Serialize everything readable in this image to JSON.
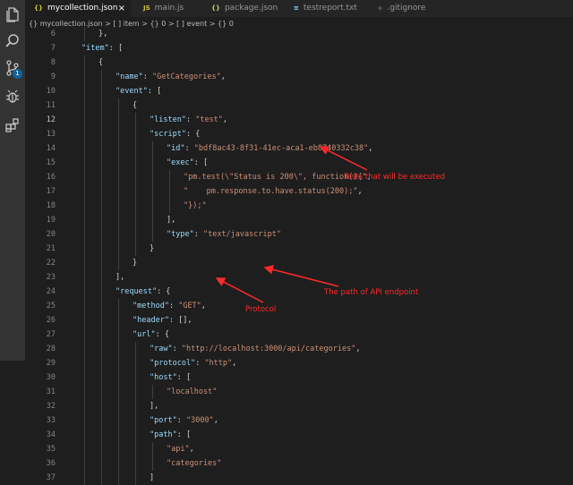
{
  "tabs": [
    {
      "icon": "{}",
      "label": "mycollection.json",
      "active": true,
      "close": "×"
    },
    {
      "icon": "JS",
      "label": "main.js"
    },
    {
      "icon": "{}",
      "label": "package.json"
    },
    {
      "icon": "≡",
      "label": "testreport.txt"
    },
    {
      "icon": "◆",
      "label": ".gitignore"
    }
  ],
  "breadcrumb": "{} mycollection.json > [ ] item > {} 0 > [ ] event > {} 0",
  "source_control_badge": "1",
  "annotations": {
    "tests": "Tests that will be executed",
    "path": "The path of API endpoint",
    "protocol": "Protocol"
  },
  "colors": {
    "annotation": "#ff2a2a",
    "key": "#9cdcfe",
    "string": "#ce9178"
  },
  "activity_icons": [
    "files-icon",
    "search-icon",
    "source-control-icon",
    "debug-icon",
    "extensions-icon"
  ],
  "lines": [
    {
      "n": "6",
      "indent": 2,
      "parts": [
        [
          "p",
          "},"
        ]
      ]
    },
    {
      "n": "7",
      "indent": 1,
      "parts": [
        [
          "k",
          "\"item\""
        ],
        [
          "p",
          ": ["
        ]
      ]
    },
    {
      "n": "8",
      "indent": 2,
      "parts": [
        [
          "p",
          "{"
        ]
      ]
    },
    {
      "n": "9",
      "indent": 3,
      "parts": [
        [
          "k",
          "\"name\""
        ],
        [
          "p",
          ": "
        ],
        [
          "s",
          "\"GetCategories\""
        ],
        [
          "p",
          ","
        ]
      ]
    },
    {
      "n": "10",
      "indent": 3,
      "parts": [
        [
          "k",
          "\"event\""
        ],
        [
          "p",
          ": ["
        ]
      ]
    },
    {
      "n": "11",
      "indent": 4,
      "parts": [
        [
          "p",
          "{"
        ]
      ]
    },
    {
      "n": "12",
      "indent": 5,
      "parts": [
        [
          "k",
          "\"listen\""
        ],
        [
          "p",
          ": "
        ],
        [
          "s",
          "\"test\""
        ],
        [
          "p",
          ","
        ]
      ]
    },
    {
      "n": "13",
      "indent": 5,
      "parts": [
        [
          "k",
          "\"script\""
        ],
        [
          "p",
          ": {"
        ]
      ]
    },
    {
      "n": "14",
      "indent": 6,
      "parts": [
        [
          "k",
          "\"id\""
        ],
        [
          "p",
          ": "
        ],
        [
          "s",
          "\"bdf8ac43-8f31-41ec-aca1-eb8740332c38\""
        ],
        [
          "p",
          ","
        ]
      ]
    },
    {
      "n": "15",
      "indent": 6,
      "parts": [
        [
          "k",
          "\"exec\""
        ],
        [
          "p",
          ": ["
        ]
      ]
    },
    {
      "n": "16",
      "indent": 7,
      "parts": [
        [
          "s",
          "\"pm.test(\\\"Status is 200\\\", function(){\""
        ],
        [
          "p",
          ","
        ]
      ]
    },
    {
      "n": "17",
      "indent": 7,
      "parts": [
        [
          "s",
          "\"    pm.response.to.have.status(200);\""
        ],
        [
          "p",
          ","
        ]
      ]
    },
    {
      "n": "18",
      "indent": 7,
      "parts": [
        [
          "s",
          "\"});\""
        ]
      ]
    },
    {
      "n": "19",
      "indent": 6,
      "parts": [
        [
          "p",
          "],"
        ]
      ]
    },
    {
      "n": "20",
      "indent": 6,
      "parts": [
        [
          "k",
          "\"type\""
        ],
        [
          "p",
          ": "
        ],
        [
          "s",
          "\"text/javascript\""
        ]
      ]
    },
    {
      "n": "21",
      "indent": 5,
      "parts": [
        [
          "p",
          "}"
        ]
      ]
    },
    {
      "n": "22",
      "indent": 4,
      "parts": [
        [
          "p",
          "}"
        ]
      ]
    },
    {
      "n": "23",
      "indent": 3,
      "parts": [
        [
          "p",
          "],"
        ]
      ]
    },
    {
      "n": "24",
      "indent": 3,
      "parts": [
        [
          "k",
          "\"request\""
        ],
        [
          "p",
          ": {"
        ]
      ]
    },
    {
      "n": "25",
      "indent": 4,
      "parts": [
        [
          "k",
          "\"method\""
        ],
        [
          "p",
          ": "
        ],
        [
          "s",
          "\"GET\""
        ],
        [
          "p",
          ","
        ]
      ]
    },
    {
      "n": "26",
      "indent": 4,
      "parts": [
        [
          "k",
          "\"header\""
        ],
        [
          "p",
          ": [],"
        ]
      ]
    },
    {
      "n": "27",
      "indent": 4,
      "parts": [
        [
          "k",
          "\"url\""
        ],
        [
          "p",
          ": {"
        ]
      ]
    },
    {
      "n": "28",
      "indent": 5,
      "parts": [
        [
          "k",
          "\"raw\""
        ],
        [
          "p",
          ": "
        ],
        [
          "s",
          "\"http://localhost:3000/api/categories\""
        ],
        [
          "p",
          ","
        ]
      ]
    },
    {
      "n": "29",
      "indent": 5,
      "parts": [
        [
          "k",
          "\"protocol\""
        ],
        [
          "p",
          ": "
        ],
        [
          "s",
          "\"http\""
        ],
        [
          "p",
          ","
        ]
      ]
    },
    {
      "n": "30",
      "indent": 5,
      "parts": [
        [
          "k",
          "\"host\""
        ],
        [
          "p",
          ": ["
        ]
      ]
    },
    {
      "n": "31",
      "indent": 6,
      "parts": [
        [
          "s",
          "\"localhost\""
        ]
      ]
    },
    {
      "n": "32",
      "indent": 5,
      "parts": [
        [
          "p",
          "],"
        ]
      ]
    },
    {
      "n": "33",
      "indent": 5,
      "parts": [
        [
          "k",
          "\"port\""
        ],
        [
          "p",
          ": "
        ],
        [
          "s",
          "\"3000\""
        ],
        [
          "p",
          ","
        ]
      ]
    },
    {
      "n": "34",
      "indent": 5,
      "parts": [
        [
          "k",
          "\"path\""
        ],
        [
          "p",
          ": ["
        ]
      ]
    },
    {
      "n": "35",
      "indent": 6,
      "parts": [
        [
          "s",
          "\"api\""
        ],
        [
          "p",
          ","
        ]
      ]
    },
    {
      "n": "36",
      "indent": 6,
      "parts": [
        [
          "s",
          "\"categories\""
        ]
      ]
    },
    {
      "n": "37",
      "indent": 5,
      "parts": [
        [
          "p",
          "]"
        ]
      ]
    }
  ]
}
